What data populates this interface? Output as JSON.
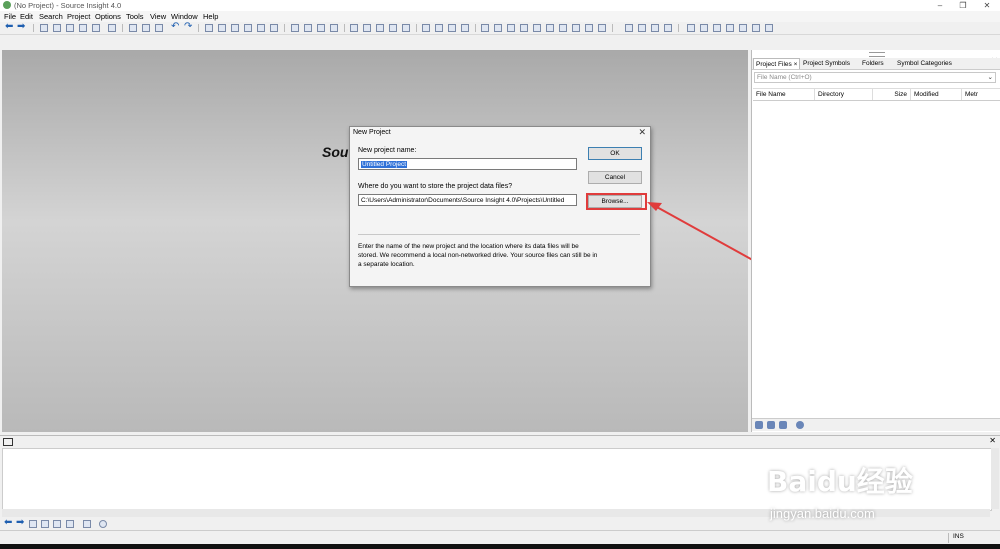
{
  "window": {
    "title": "(No Project) - Source Insight 4.0"
  },
  "menu": [
    "File",
    "Edit",
    "Search",
    "Project",
    "Options",
    "Tools",
    "View",
    "Window",
    "Help"
  ],
  "workspace": {
    "partial_text": "Sou"
  },
  "dialog": {
    "title": "New Project",
    "close_glyph": "✕",
    "name_label": "New project name:",
    "name_value": "Untitled Project",
    "location_label": "Where do you want to store the project data files?",
    "location_value": "C:\\Users\\Administrator\\Documents\\Source Insight 4.0\\Projects\\Untitled",
    "ok_label": "OK",
    "cancel_label": "Cancel",
    "browse_label": "Browse...",
    "description": "Enter the name of the new project and the location where its data files will be stored. We recommend a local non-networked drive. Your source files can still be in a separate location."
  },
  "right_panel": {
    "tabs": [
      "Project Files ×",
      "Project Symbols",
      "Folders",
      "Symbol Categories"
    ],
    "close_glyph": "✕",
    "search_placeholder": "File Name (Ctrl+O)",
    "columns": [
      "File Name",
      "Directory",
      "Size",
      "Modified",
      "Metr"
    ]
  },
  "bottom_panel": {
    "close_glyph": "✕"
  },
  "status_bar": {
    "mode": "INS"
  },
  "watermark": {
    "brand": "Baidu经验",
    "url": "jingyan.baidu.com"
  },
  "colors": {
    "highlight": "#e03c3c",
    "selection": "#3072d8"
  }
}
